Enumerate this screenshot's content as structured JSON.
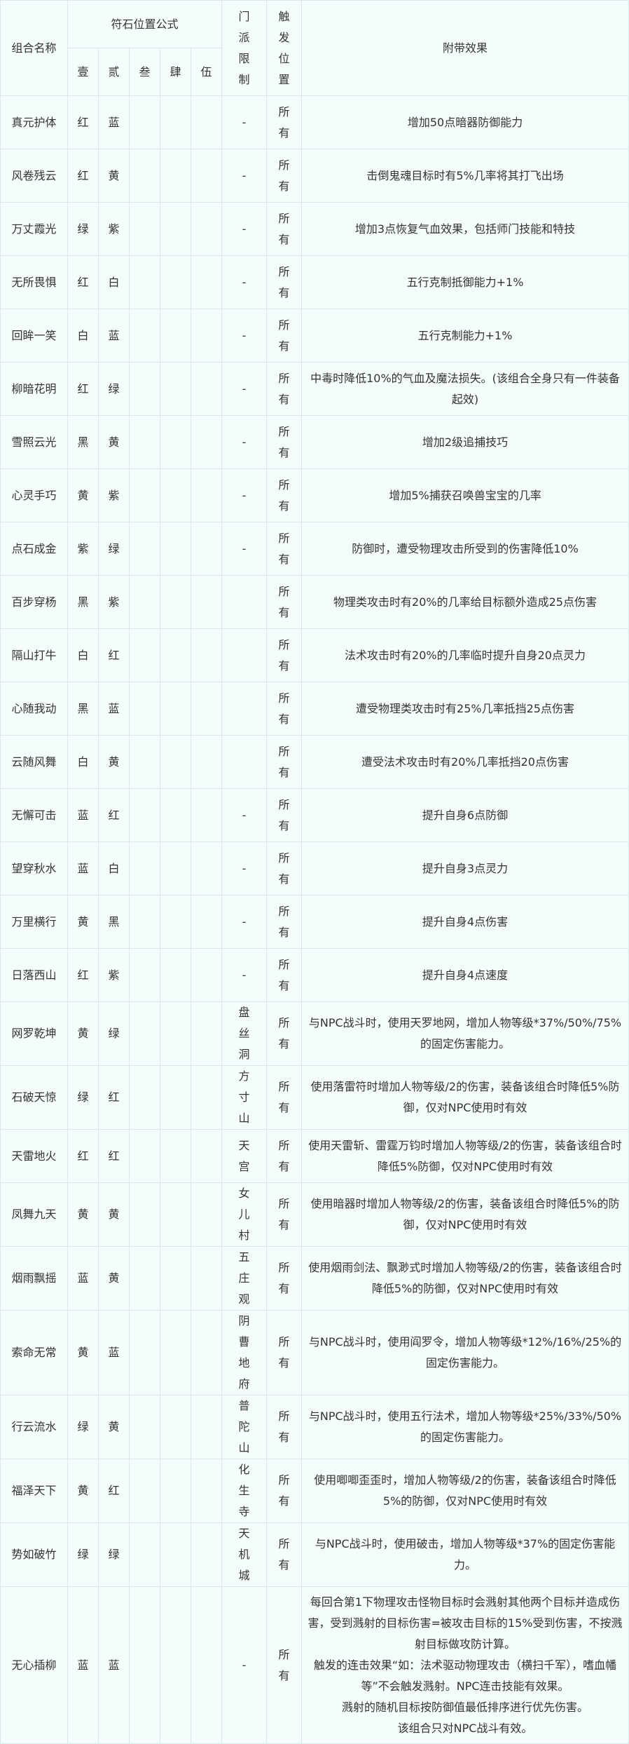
{
  "header": {
    "name_col": "组合名称",
    "formula_col": "符石位置公式",
    "pos": [
      "壹",
      "贰",
      "叁",
      "肆",
      "伍"
    ],
    "sect_col": "门派限制",
    "trigger_col": "触发位置",
    "effect_col": "附带效果"
  },
  "rows": [
    {
      "name": "真元护体",
      "p1": "红",
      "p2": "蓝",
      "sect": "-",
      "trigger": "所有",
      "effect": "增加50点暗器防御能力"
    },
    {
      "name": "风卷残云",
      "p1": "红",
      "p2": "黄",
      "sect": "-",
      "trigger": "所有",
      "effect": "击倒鬼魂目标时有5%几率将其打飞出场"
    },
    {
      "name": "万丈霞光",
      "p1": "绿",
      "p2": "紫",
      "sect": "-",
      "trigger": "所有",
      "effect": "增加3点恢复气血效果，包括师门技能和特技"
    },
    {
      "name": "无所畏惧",
      "p1": "红",
      "p2": "白",
      "sect": "-",
      "trigger": "所有",
      "effect": "五行克制抵御能力+1%"
    },
    {
      "name": "回眸一笑",
      "p1": "白",
      "p2": "蓝",
      "sect": "-",
      "trigger": "所有",
      "effect": "五行克制能力+1%"
    },
    {
      "name": "柳暗花明",
      "p1": "红",
      "p2": "绿",
      "sect": "-",
      "trigger": "所有",
      "effect": "中毒时降低10%的气血及魔法损失。(该组合全身只有一件装备起效)"
    },
    {
      "name": "雪照云光",
      "p1": "黑",
      "p2": "黄",
      "sect": "-",
      "trigger": "所有",
      "effect": "增加2级追捕技巧"
    },
    {
      "name": "心灵手巧",
      "p1": "黄",
      "p2": "紫",
      "sect": "-",
      "trigger": "所有",
      "effect": "增加5%捕获召唤兽宝宝的几率"
    },
    {
      "name": "点石成金",
      "p1": "紫",
      "p2": "绿",
      "sect": "-",
      "trigger": "所有",
      "effect": "防御时，遭受物理攻击所受到的伤害降低10%"
    },
    {
      "name": "百步穿杨",
      "p1": "黑",
      "p2": "紫",
      "sect": "",
      "trigger": "所有",
      "effect": "物理类攻击时有20%的几率给目标额外造成25点伤害"
    },
    {
      "name": "隔山打牛",
      "p1": "白",
      "p2": "红",
      "sect": "",
      "trigger": "所有",
      "effect": "法术攻击时有20%的几率临时提升自身20点灵力"
    },
    {
      "name": "心随我动",
      "p1": "黑",
      "p2": "蓝",
      "sect": "",
      "trigger": "所有",
      "effect": "遭受物理类攻击时有25%几率抵挡25点伤害"
    },
    {
      "name": "云随风舞",
      "p1": "白",
      "p2": "黄",
      "sect": "",
      "trigger": "所有",
      "effect": "遭受法术攻击时有20%几率抵挡20点伤害"
    },
    {
      "name": "无懈可击",
      "p1": "蓝",
      "p2": "红",
      "sect": "-",
      "trigger": "所有",
      "effect": "提升自身6点防御"
    },
    {
      "name": "望穿秋水",
      "p1": "蓝",
      "p2": "白",
      "sect": "-",
      "trigger": "所有",
      "effect": "提升自身3点灵力"
    },
    {
      "name": "万里横行",
      "p1": "黄",
      "p2": "黑",
      "sect": "-",
      "trigger": "所有",
      "effect": "提升自身4点伤害"
    },
    {
      "name": "日落西山",
      "p1": "红",
      "p2": "紫",
      "sect": "-",
      "trigger": "所有",
      "effect": "提升自身4点速度"
    },
    {
      "name": "网罗乾坤",
      "p1": "黄",
      "p2": "绿",
      "sect": "盘丝洞",
      "trigger": "所有",
      "effect": "与NPC战斗时，使用天罗地网，增加人物等级*37%/50%/75%的固定伤害能力。"
    },
    {
      "name": "石破天惊",
      "p1": "绿",
      "p2": "红",
      "sect": "方寸山",
      "trigger": "所有",
      "effect": "使用落雷符时增加人物等级/2的伤害，装备该组合时降低5%防御，仅对NPC使用时有效"
    },
    {
      "name": "天雷地火",
      "p1": "红",
      "p2": "红",
      "sect": "天宫",
      "trigger": "所有",
      "effect": "使用天雷斩、雷霆万钧时增加人物等级/2的伤害，装备该组合时降低5%防御，仅对NPC使用时有效"
    },
    {
      "name": "凤舞九天",
      "p1": "黄",
      "p2": "黄",
      "sect": "女儿村",
      "trigger": "所有",
      "effect": "使用暗器时增加人物等级/2的伤害，装备该组合时降低5%的防御，仅对NPC使用时有效"
    },
    {
      "name": "烟雨飘摇",
      "p1": "蓝",
      "p2": "黄",
      "sect": "五庄观",
      "trigger": "所有",
      "effect": "使用烟雨剑法、飘渺式时增加人物等级/2的伤害，装备该组合时降低5%的防御，仅对NPC使用时有效"
    },
    {
      "name": "索命无常",
      "p1": "黄",
      "p2": "蓝",
      "sect": "阴曹地府",
      "trigger": "所有",
      "effect": "与NPC战斗时，使用阎罗令，增加人物等级*12%/16%/25%的固定伤害能力。"
    },
    {
      "name": "行云流水",
      "p1": "绿",
      "p2": "黄",
      "sect": "普陀山",
      "trigger": "所有",
      "effect": "与NPC战斗时，使用五行法术，增加人物等级*25%/33%/50%的固定伤害能力。"
    },
    {
      "name": "福泽天下",
      "p1": "黄",
      "p2": "红",
      "sect": "化生寺",
      "trigger": "所有",
      "effect": "使用唧唧歪歪时，增加人物等级/2的伤害，装备该组合时降低5%的防御，仅对NPC使用时有效"
    },
    {
      "name": "势如破竹",
      "p1": "绿",
      "p2": "绿",
      "sect": "天机城",
      "trigger": "所有",
      "effect": "与NPC战斗时，使用破击，增加人物等级*37%的固定伤害能力。"
    },
    {
      "name": "无心插柳",
      "p1": "蓝",
      "p2": "蓝",
      "sect": "-",
      "trigger": "所有",
      "tall": true,
      "effect_lines": [
        "每回合第1下物理攻击怪物目标时会溅射其他两个目标并造成伤害，受到溅射的目标伤害=被攻击目标的15%受到伤害，不按溅射目标做攻防计算。",
        "触发的连击效果“如：法术驱动物理攻击（横扫千军），嗜血幡等”不会触发溅射。NPC连击技能有效果。",
        "溅射的随机目标按防御值最低排序进行优先伤害。",
        "该组合只对NPC战斗有效。"
      ]
    }
  ]
}
